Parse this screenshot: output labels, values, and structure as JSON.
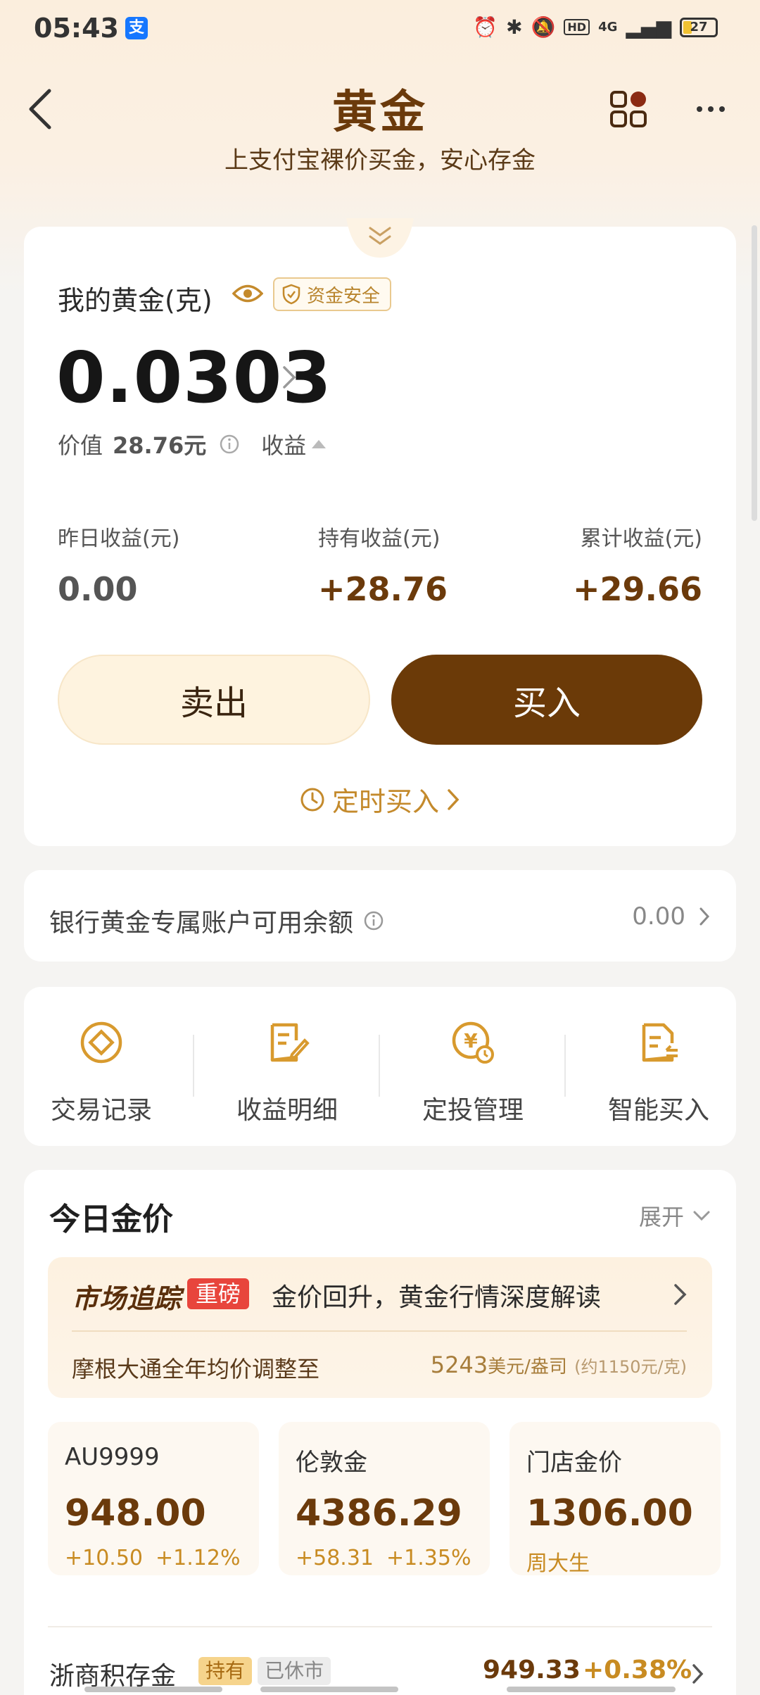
{
  "status": {
    "time": "05:43",
    "battery": "27",
    "net": "4G",
    "hd": "HD",
    "app_badge": "支"
  },
  "header": {
    "title": "黄金",
    "subtitle": "上支付宝裸价买金，安心存金"
  },
  "holding": {
    "label": "我的黄金(克)",
    "safe_badge": "资金安全",
    "grams": "0.0303",
    "value_label": "价值",
    "value_amount": "28.76元",
    "profit_label": "收益"
  },
  "stats": [
    {
      "label": "昨日收益(元)",
      "value": "0.00"
    },
    {
      "label": "持有收益(元)",
      "value": "+28.76"
    },
    {
      "label": "累计收益(元)",
      "value": "+29.66"
    }
  ],
  "actions": {
    "sell": "卖出",
    "buy": "买入",
    "timed_buy": "定时买入"
  },
  "bank": {
    "label": "银行黄金专属账户可用余额",
    "value": "0.00"
  },
  "quick": [
    {
      "label": "交易记录",
      "icon": "record-icon"
    },
    {
      "label": "收益明细",
      "icon": "detail-icon"
    },
    {
      "label": "定投管理",
      "icon": "plan-icon"
    },
    {
      "label": "智能买入",
      "icon": "smart-buy-icon"
    }
  ],
  "price": {
    "title": "今日金价",
    "expand": "展开",
    "market": {
      "logo": "市场追踪",
      "tag": "重磅",
      "headline": "金价回升，黄金行情深度解读",
      "sub_label": "摩根大通全年均价调整至",
      "sub_value": "5243",
      "sub_unit": "美元/盎司",
      "sub_approx": "(约1150元/克)"
    },
    "cards": [
      {
        "name": "AU9999",
        "value": "948.00",
        "change": "+10.50",
        "pct": "+1.12%"
      },
      {
        "name": "伦敦金",
        "value": "4386.29",
        "change": "+58.31",
        "pct": "+1.35%"
      },
      {
        "name": "门店金价",
        "value": "1306.00",
        "brand": "周大生"
      }
    ],
    "row": {
      "name": "浙商积存金",
      "tag_hold": "持有",
      "tag_closed": "已休市",
      "price": "949.33",
      "pct": "+0.38%"
    }
  },
  "colors": {
    "brand_brown": "#6b3a08",
    "gold": "#c88b22",
    "alert_red": "#e8453c"
  }
}
